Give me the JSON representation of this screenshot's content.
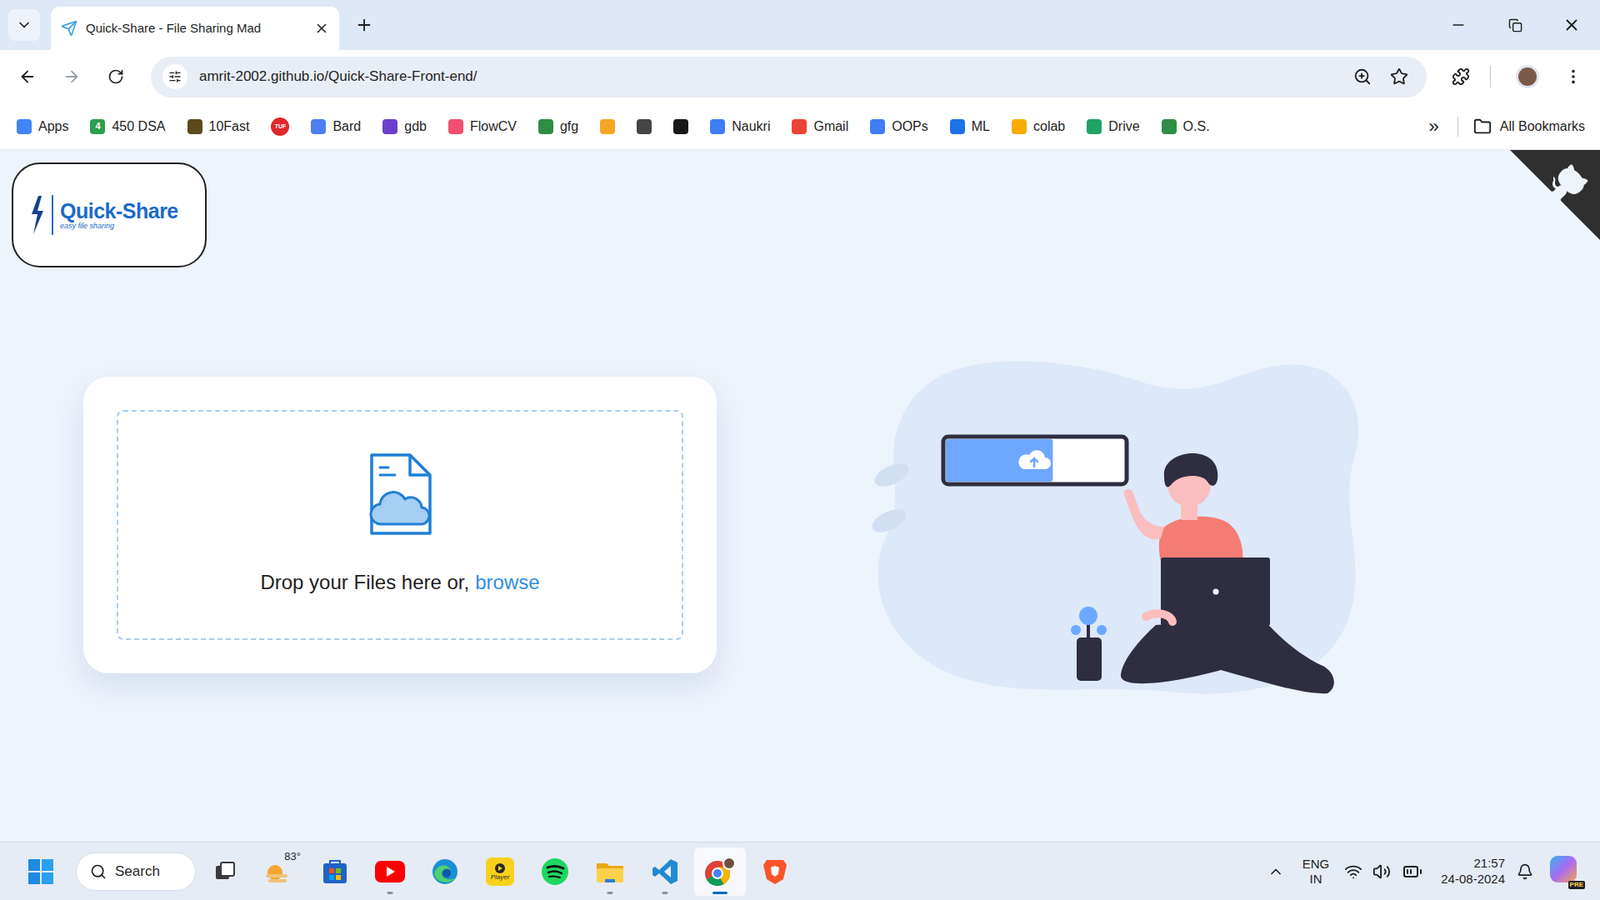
{
  "browser": {
    "tabs": [
      {
        "title": "Quick-Share - File Sharing Mad",
        "selected": true
      }
    ],
    "address": "amrit-2002.github.io/Quick-Share-Front-end/",
    "bookmarks": [
      {
        "label": "Apps",
        "color": "#4285f4"
      },
      {
        "label": "450 DSA",
        "icon_text": "4",
        "color": "#2e9e4f"
      },
      {
        "label": "10Fast",
        "color": "#5b4a1c"
      },
      {
        "icon_text": "TUF",
        "color": "#e0282c"
      },
      {
        "label": "Bard",
        "color": "#4d7ff0"
      },
      {
        "label": "gdb",
        "color": "#6a3fd0"
      },
      {
        "label": "FlowCV",
        "color": "#f0506e"
      },
      {
        "label": "gfg",
        "color": "#2f8d46"
      },
      {
        "color": "#f5a623"
      },
      {
        "color": "#444444"
      },
      {
        "color": "#181717"
      },
      {
        "label": "Naukri",
        "color": "#3f7df6"
      },
      {
        "label": "Gmail",
        "color": "#ea4335"
      },
      {
        "label": "OOPs",
        "color": "#3f7df6"
      },
      {
        "label": "ML",
        "color": "#1a73e8"
      },
      {
        "label": "colab",
        "color": "#f9ab00"
      },
      {
        "label": "Drive",
        "color": "#1fa463"
      },
      {
        "label": "O.S.",
        "color": "#2f8d46"
      }
    ],
    "bookmarks_more": "»",
    "all_bookmarks": "All Bookmarks"
  },
  "page": {
    "logo": {
      "title": "Quick-Share",
      "tagline": "easy file sharing"
    },
    "dropzone": {
      "text": "Drop your Files here or,",
      "link": "browse"
    },
    "illustration": {
      "upload_level": 0.6
    }
  },
  "taskbar": {
    "search": "Search",
    "apps": [
      {
        "kind": "taskview",
        "running": false,
        "active": false
      },
      {
        "kind": "weather",
        "badge": "83°",
        "running": false,
        "active": false
      },
      {
        "kind": "store",
        "running": false,
        "active": false
      },
      {
        "kind": "youtube",
        "running": true,
        "active": false
      },
      {
        "kind": "edge",
        "running": false,
        "active": false
      },
      {
        "kind": "player",
        "badge": "Player",
        "running": false,
        "active": false
      },
      {
        "kind": "spotify",
        "running": false,
        "active": false
      },
      {
        "kind": "explorer",
        "running": true,
        "active": false
      },
      {
        "kind": "vscode",
        "running": true,
        "active": false
      },
      {
        "kind": "chrome",
        "running": true,
        "active": true
      },
      {
        "kind": "brave",
        "running": false,
        "active": false
      }
    ],
    "tray": {
      "language": "ENG",
      "region": "IN",
      "time": "21:57",
      "date": "24-08-2024",
      "copilot_badge": "PRE"
    }
  }
}
